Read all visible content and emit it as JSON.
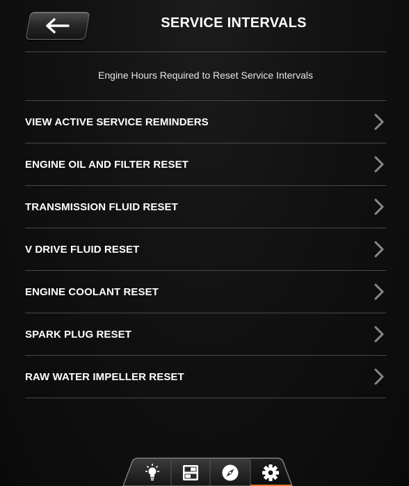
{
  "header": {
    "title": "SERVICE INTERVALS",
    "back_icon": "arrow-left-icon"
  },
  "subtitle": "Engine Hours Required to Reset Service Intervals",
  "menu": {
    "items": [
      {
        "label": "VIEW ACTIVE SERVICE REMINDERS",
        "icon": "chevron-right-icon"
      },
      {
        "label": "ENGINE OIL AND FILTER RESET",
        "icon": "chevron-right-icon"
      },
      {
        "label": "TRANSMISSION FLUID RESET",
        "icon": "chevron-right-icon"
      },
      {
        "label": "V DRIVE FLUID RESET",
        "icon": "chevron-right-icon"
      },
      {
        "label": "ENGINE COOLANT RESET",
        "icon": "chevron-right-icon"
      },
      {
        "label": "SPARK PLUG RESET",
        "icon": "chevron-right-icon"
      },
      {
        "label": "RAW WATER IMPELLER RESET",
        "icon": "chevron-right-icon"
      }
    ]
  },
  "tabbar": {
    "tabs": [
      {
        "icon": "lightbulb-icon"
      },
      {
        "icon": "switches-icon"
      },
      {
        "icon": "compass-icon"
      },
      {
        "icon": "gear-icon",
        "active": true
      }
    ],
    "accent_color": "#e8772e"
  },
  "colors": {
    "background": "#121212",
    "text": "#ffffff",
    "divider": "#4a4a4a",
    "chevron": "#8a8a8a"
  }
}
